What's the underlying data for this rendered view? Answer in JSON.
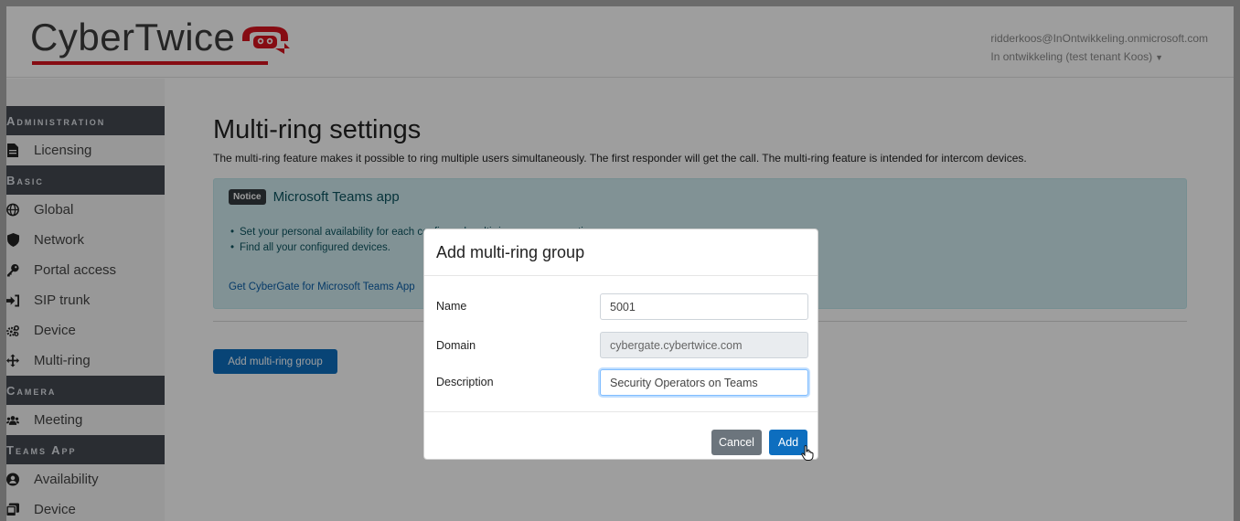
{
  "header": {
    "logo_text": "CyberTwice",
    "user_email": "ridderkoos@InOntwikkeling.onmicrosoft.com",
    "tenant": "In ontwikkeling (test tenant Koos)"
  },
  "sidebar": {
    "sections": [
      {
        "title": "Administration",
        "items": [
          {
            "label": "Licensing",
            "icon": "file-icon"
          }
        ]
      },
      {
        "title": "Basic",
        "items": [
          {
            "label": "Global",
            "icon": "globe-icon"
          },
          {
            "label": "Network",
            "icon": "shield-icon"
          },
          {
            "label": "Portal access",
            "icon": "key-icon"
          },
          {
            "label": "SIP trunk",
            "icon": "sign-in-icon"
          },
          {
            "label": "Device",
            "icon": "cogs-icon"
          },
          {
            "label": "Multi-ring",
            "icon": "arrows-icon"
          }
        ]
      },
      {
        "title": "Camera",
        "items": [
          {
            "label": "Meeting",
            "icon": "users-icon"
          }
        ]
      },
      {
        "title": "Teams App",
        "items": [
          {
            "label": "Availability",
            "icon": "user-circle-icon"
          },
          {
            "label": "Device",
            "icon": "tablet-icon"
          }
        ]
      }
    ]
  },
  "main": {
    "title": "Multi-ring settings",
    "description": "The multi-ring feature makes it possible to ring multiple users simultaneously. The first responder will get the call. The multi-ring feature is intended for intercom devices.",
    "notice": {
      "badge": "Notice",
      "title": "Microsoft Teams app",
      "items": [
        "Set your personal availability for each configured multi-ring group or meeting.",
        "Find all your configured devices."
      ],
      "link": "Get CyberGate for Microsoft Teams App"
    },
    "add_button": "Add multi-ring group"
  },
  "modal": {
    "title": "Add multi-ring group",
    "fields": [
      {
        "label": "Name",
        "value": "5001"
      },
      {
        "label": "Domain",
        "value": "cybergate.cybertwice.com"
      },
      {
        "label": "Description",
        "value": "Security Operators on Teams"
      }
    ],
    "cancel": "Cancel",
    "add": "Add"
  },
  "colors": {
    "accent": "#0d6ebf",
    "sidebar_section": "#444a52",
    "logo_red": "#d8141f",
    "notice_bg": "#d1ecf1"
  }
}
